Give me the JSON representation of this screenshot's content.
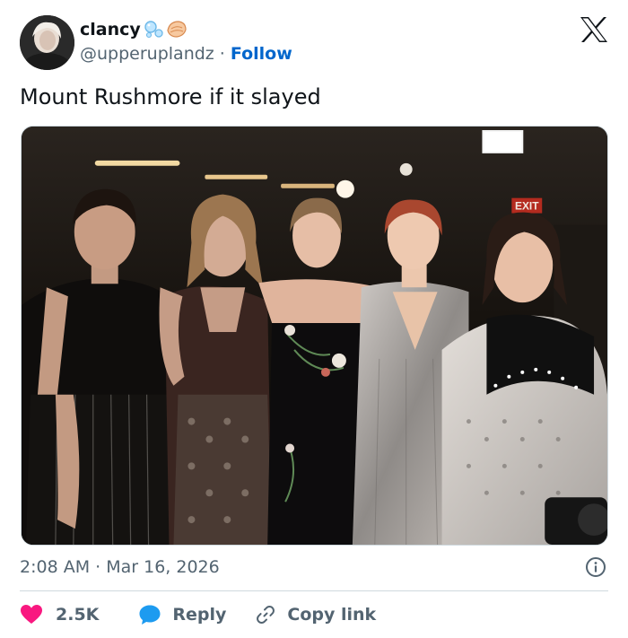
{
  "user": {
    "display_name": "clancy",
    "handle": "@upperuplandz",
    "separator": " · ",
    "follow_label": "Follow",
    "badges": [
      "bubbles-emoji",
      "shell-emoji"
    ]
  },
  "tweet": {
    "text": "Mount Rushmore if it slayed",
    "timestamp": "2:08 AM · Mar 16, 2026"
  },
  "actions": {
    "likes": "2.5K",
    "reply_label": "Reply",
    "copy_label": "Copy link"
  },
  "photo": {
    "exit_sign": "EXIT"
  },
  "colors": {
    "text": "#0f1419",
    "secondary": "#536471",
    "link": "#0066cc",
    "heart": "#f91880",
    "reply": "#1d9bf0",
    "divider": "#cfd9de"
  },
  "icons": [
    "x-logo-icon",
    "info-icon",
    "heart-icon",
    "reply-bubble-icon",
    "link-icon"
  ]
}
